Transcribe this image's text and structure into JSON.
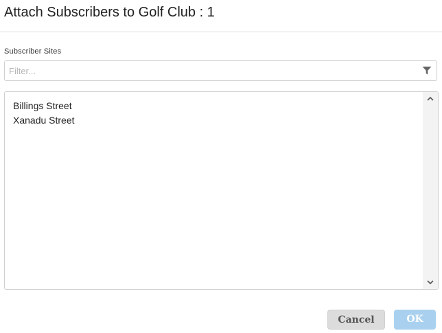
{
  "dialog": {
    "title": "Attach Subscribers to Golf Club : 1"
  },
  "subscriber_sites": {
    "label": "Subscriber Sites",
    "filter_placeholder": "Filter...",
    "filter_value": "",
    "filter_icon": "filter-funnel-icon",
    "items": [
      {
        "label": "Billings Street"
      },
      {
        "label": "Xanadu Street"
      }
    ]
  },
  "buttons": {
    "cancel_label": "Cancel",
    "ok_label": "OK"
  },
  "colors": {
    "ok_button": "#a9d1ef",
    "cancel_button": "#dcdcdc"
  }
}
